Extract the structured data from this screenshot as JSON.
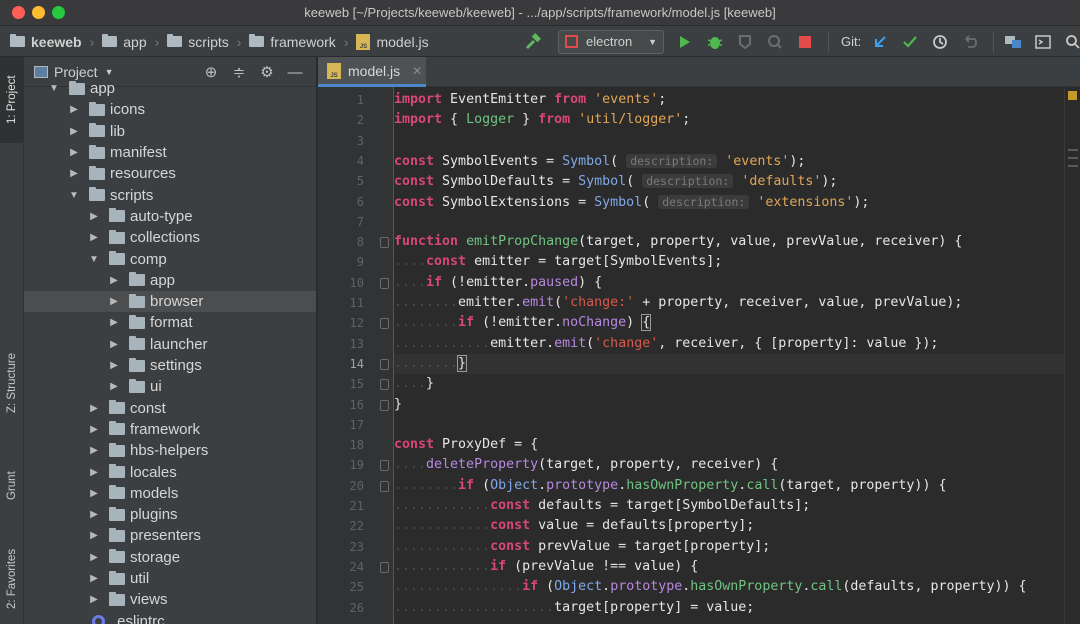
{
  "window": {
    "title": "keeweb [~/Projects/keeweb/keeweb] - .../app/scripts/framework/model.js [keeweb]"
  },
  "breadcrumbs": [
    "keeweb",
    "app",
    "scripts",
    "framework",
    "model.js"
  ],
  "toolbar": {
    "run_config": "electron",
    "git_label": "Git:"
  },
  "left_strip": {
    "tabs": [
      "1: Project",
      "Z: Structure",
      "Grunt",
      "2: Favorites"
    ]
  },
  "project_panel": {
    "title": "Project"
  },
  "tree": [
    {
      "label": "app",
      "level": 1,
      "expanded": true
    },
    {
      "label": "icons",
      "level": 2,
      "expanded": false
    },
    {
      "label": "lib",
      "level": 2,
      "expanded": false
    },
    {
      "label": "manifest",
      "level": 2,
      "expanded": false
    },
    {
      "label": "resources",
      "level": 2,
      "expanded": false
    },
    {
      "label": "scripts",
      "level": 2,
      "expanded": true
    },
    {
      "label": "auto-type",
      "level": 3,
      "expanded": false
    },
    {
      "label": "collections",
      "level": 3,
      "expanded": false
    },
    {
      "label": "comp",
      "level": 3,
      "expanded": true
    },
    {
      "label": "app",
      "level": 4,
      "expanded": false
    },
    {
      "label": "browser",
      "level": 4,
      "expanded": false,
      "selected": true
    },
    {
      "label": "format",
      "level": 4,
      "expanded": false
    },
    {
      "label": "launcher",
      "level": 4,
      "expanded": false
    },
    {
      "label": "settings",
      "level": 4,
      "expanded": false
    },
    {
      "label": "ui",
      "level": 4,
      "expanded": false
    },
    {
      "label": "const",
      "level": 3,
      "expanded": false
    },
    {
      "label": "framework",
      "level": 3,
      "expanded": false
    },
    {
      "label": "hbs-helpers",
      "level": 3,
      "expanded": false
    },
    {
      "label": "locales",
      "level": 3,
      "expanded": false
    },
    {
      "label": "models",
      "level": 3,
      "expanded": false
    },
    {
      "label": "plugins",
      "level": 3,
      "expanded": false
    },
    {
      "label": "presenters",
      "level": 3,
      "expanded": false
    },
    {
      "label": "storage",
      "level": 3,
      "expanded": false
    },
    {
      "label": "util",
      "level": 3,
      "expanded": false
    },
    {
      "label": "views",
      "level": 3,
      "expanded": false
    },
    {
      "label": ".eslintrc",
      "level": 3,
      "file": true
    }
  ],
  "editor": {
    "tab_label": "model.js",
    "current_line": 14,
    "lines": [
      {
        "n": "1",
        "tokens": [
          [
            "kw2",
            "import"
          ],
          [
            "plain",
            " EventEmitter "
          ],
          [
            "kw2",
            "from"
          ],
          [
            "plain",
            " "
          ],
          [
            "str",
            "'events'"
          ],
          [
            "plain",
            ";"
          ]
        ]
      },
      {
        "n": "2",
        "tokens": [
          [
            "kw2",
            "import"
          ],
          [
            "plain",
            " { "
          ],
          [
            "fn",
            "Logger"
          ],
          [
            "plain",
            " } "
          ],
          [
            "kw2",
            "from"
          ],
          [
            "plain",
            " "
          ],
          [
            "str",
            "'util/logger'"
          ],
          [
            "plain",
            ";"
          ]
        ]
      },
      {
        "n": "3",
        "tokens": []
      },
      {
        "n": "4",
        "tokens": [
          [
            "kw2",
            "const"
          ],
          [
            "plain",
            " SymbolEvents = "
          ],
          [
            "cls",
            "Symbol"
          ],
          [
            "plain",
            "( "
          ],
          [
            "hint",
            "description:"
          ],
          [
            "plain",
            " "
          ],
          [
            "str",
            "'events'"
          ],
          [
            "plain",
            ");"
          ]
        ]
      },
      {
        "n": "5",
        "tokens": [
          [
            "kw2",
            "const"
          ],
          [
            "plain",
            " SymbolDefaults = "
          ],
          [
            "cls",
            "Symbol"
          ],
          [
            "plain",
            "( "
          ],
          [
            "hint",
            "description:"
          ],
          [
            "plain",
            " "
          ],
          [
            "str",
            "'defaults'"
          ],
          [
            "plain",
            ");"
          ]
        ]
      },
      {
        "n": "6",
        "tokens": [
          [
            "kw2",
            "const"
          ],
          [
            "plain",
            " SymbolExtensions = "
          ],
          [
            "cls",
            "Symbol"
          ],
          [
            "plain",
            "( "
          ],
          [
            "hint",
            "description:"
          ],
          [
            "plain",
            " "
          ],
          [
            "str",
            "'extensions'"
          ],
          [
            "plain",
            ");"
          ]
        ]
      },
      {
        "n": "7",
        "tokens": []
      },
      {
        "n": "8",
        "tokens": [
          [
            "kw2",
            "function"
          ],
          [
            "plain",
            " "
          ],
          [
            "fn",
            "emitPropChange"
          ],
          [
            "plain",
            "(target, property, value, prevValue, receiver) {"
          ]
        ]
      },
      {
        "n": "9",
        "tokens": [
          [
            "dots",
            "...."
          ],
          [
            "kw2",
            "const"
          ],
          [
            "plain",
            " emitter = target[SymbolEvents];"
          ]
        ]
      },
      {
        "n": "10",
        "tokens": [
          [
            "dots",
            "...."
          ],
          [
            "kw2",
            "if"
          ],
          [
            "plain",
            " (!emitter."
          ],
          [
            "prop",
            "paused"
          ],
          [
            "plain",
            ") {"
          ]
        ]
      },
      {
        "n": "11",
        "tokens": [
          [
            "dots",
            "........"
          ],
          [
            "plain",
            "emitter."
          ],
          [
            "prop",
            "emit"
          ],
          [
            "plain",
            "("
          ],
          [
            "strp",
            "'change:'"
          ],
          [
            "plain",
            " + property, receiver, value, prevValue);"
          ]
        ]
      },
      {
        "n": "12",
        "tokens": [
          [
            "dots",
            "........"
          ],
          [
            "kw2",
            "if"
          ],
          [
            "plain",
            " (!emitter."
          ],
          [
            "prop",
            "noChange"
          ],
          [
            "plain",
            ") "
          ],
          [
            "caret",
            "{"
          ]
        ]
      },
      {
        "n": "13",
        "tokens": [
          [
            "dots",
            "............"
          ],
          [
            "plain",
            "emitter."
          ],
          [
            "prop",
            "emit"
          ],
          [
            "plain",
            "("
          ],
          [
            "strp",
            "'change'"
          ],
          [
            "plain",
            ", receiver, { [property]: value });"
          ]
        ]
      },
      {
        "n": "14",
        "tokens": [
          [
            "dots",
            "........"
          ],
          [
            "caret",
            "}"
          ]
        ]
      },
      {
        "n": "15",
        "tokens": [
          [
            "dots",
            "...."
          ],
          [
            "plain",
            "}"
          ]
        ]
      },
      {
        "n": "16",
        "tokens": [
          [
            "plain",
            "}"
          ]
        ]
      },
      {
        "n": "17",
        "tokens": []
      },
      {
        "n": "18",
        "tokens": [
          [
            "kw2",
            "const"
          ],
          [
            "plain",
            " ProxyDef = {"
          ]
        ]
      },
      {
        "n": "19",
        "tokens": [
          [
            "dots",
            "...."
          ],
          [
            "prop",
            "deleteProperty"
          ],
          [
            "plain",
            "(target, property, receiver) {"
          ]
        ]
      },
      {
        "n": "20",
        "tokens": [
          [
            "dots",
            "........"
          ],
          [
            "kw2",
            "if"
          ],
          [
            "plain",
            " ("
          ],
          [
            "cls",
            "Object"
          ],
          [
            "plain",
            "."
          ],
          [
            "prop",
            "prototype"
          ],
          [
            "plain",
            "."
          ],
          [
            "fn",
            "hasOwnProperty"
          ],
          [
            "plain",
            "."
          ],
          [
            "fn",
            "call"
          ],
          [
            "plain",
            "(target, property)) {"
          ]
        ]
      },
      {
        "n": "21",
        "tokens": [
          [
            "dots",
            "............"
          ],
          [
            "kw2",
            "const"
          ],
          [
            "plain",
            " defaults = target[SymbolDefaults];"
          ]
        ]
      },
      {
        "n": "22",
        "tokens": [
          [
            "dots",
            "............"
          ],
          [
            "kw2",
            "const"
          ],
          [
            "plain",
            " value = defaults[property];"
          ]
        ]
      },
      {
        "n": "23",
        "tokens": [
          [
            "dots",
            "............"
          ],
          [
            "kw2",
            "const"
          ],
          [
            "plain",
            " prevValue = target[property];"
          ]
        ]
      },
      {
        "n": "24",
        "tokens": [
          [
            "dots",
            "............"
          ],
          [
            "kw2",
            "if"
          ],
          [
            "plain",
            " (prevValue !== value) {"
          ]
        ]
      },
      {
        "n": "25",
        "tokens": [
          [
            "dots",
            "................"
          ],
          [
            "kw2",
            "if"
          ],
          [
            "plain",
            " ("
          ],
          [
            "cls",
            "Object"
          ],
          [
            "plain",
            "."
          ],
          [
            "prop",
            "prototype"
          ],
          [
            "plain",
            "."
          ],
          [
            "fn",
            "hasOwnProperty"
          ],
          [
            "plain",
            "."
          ],
          [
            "fn",
            "call"
          ],
          [
            "plain",
            "(defaults, property)) {"
          ]
        ]
      },
      {
        "n": "26",
        "tokens": [
          [
            "dots",
            "...................."
          ],
          [
            "plain",
            "target[property] = value;"
          ]
        ]
      }
    ]
  },
  "colors": {
    "keyword": "#d8467a",
    "string": "#e2a655",
    "function": "#6fc482",
    "class": "#7fa9e8",
    "property": "#b888e0",
    "run_green": "#4fb84f",
    "stop_red": "#e34a4a"
  },
  "icons": [
    "hammer-icon",
    "run-icon",
    "debug-icon",
    "coverage-icon",
    "profile-icon",
    "stop-icon",
    "git-update-icon",
    "git-commit-icon",
    "git-history-icon",
    "git-revert-icon",
    "project-structure-icon",
    "terminal-icon",
    "search-icon",
    "locate-icon",
    "collapse-icon",
    "settings-icon",
    "hide-icon",
    "lightbulb-icon"
  ]
}
